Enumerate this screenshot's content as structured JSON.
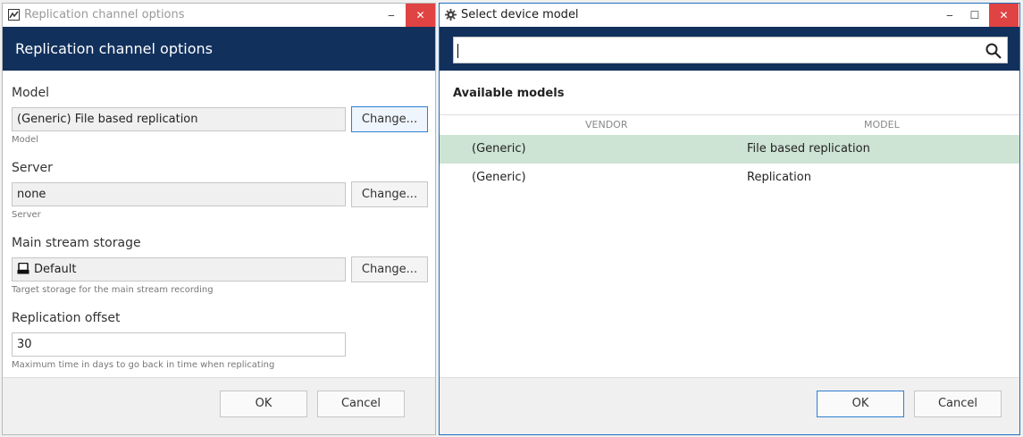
{
  "left_window": {
    "title": "Replication channel options",
    "header_title": "Replication channel options",
    "minimize_glyph": "‒",
    "close_glyph": "✕",
    "fields": [
      {
        "label": "Model",
        "value": "(Generic) File based replication",
        "hint": "Model",
        "button": "Change..."
      },
      {
        "label": "Server",
        "value": "none",
        "hint": "Server",
        "button": "Change..."
      },
      {
        "label": "Main stream storage",
        "value": "Default",
        "hint": "Target storage for the main stream recording",
        "button": "Change...",
        "icon": "storage-drive-icon"
      },
      {
        "label": "Replication offset",
        "value": "30",
        "hint": "Maximum time in days to go back in time when replicating"
      }
    ],
    "ok_label": "OK",
    "cancel_label": "Cancel"
  },
  "right_window": {
    "title": "Select device model",
    "minimize_glyph": "‒",
    "maximize_glyph": "☐",
    "close_glyph": "✕",
    "search": {
      "value": "",
      "icon": "search-icon"
    },
    "section_title": "Available models",
    "columns": [
      "VENDOR",
      "MODEL"
    ],
    "rows": [
      {
        "vendor": "(Generic)",
        "model": "File based replication",
        "selected": true
      },
      {
        "vendor": "(Generic)",
        "model": "Replication",
        "selected": false
      }
    ],
    "ok_label": "OK",
    "cancel_label": "Cancel"
  },
  "colors": {
    "header_band": "#11305c",
    "selected_row": "#cde3d3",
    "close_button": "#e04343",
    "focus_border": "#2d7fd2"
  }
}
